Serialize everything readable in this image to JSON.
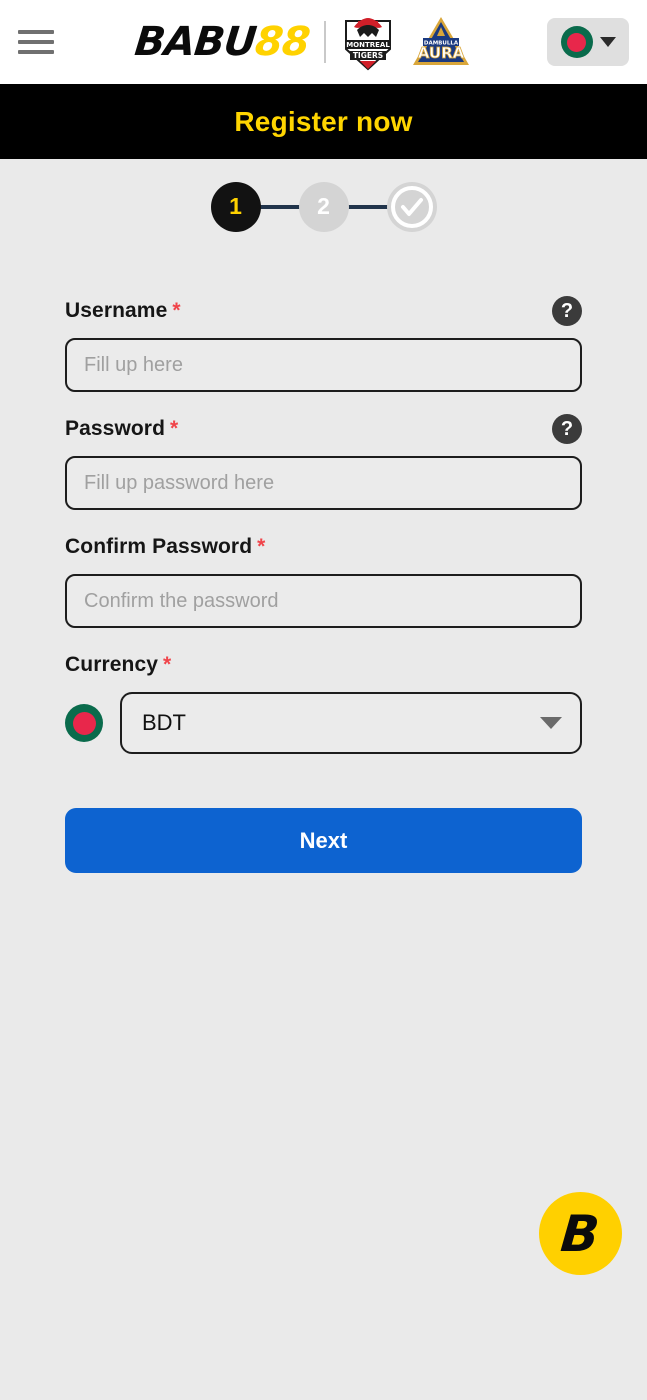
{
  "header": {
    "menu_icon": "hamburger-icon",
    "logo": {
      "primary": "BABU",
      "accent": "88"
    },
    "sponsors": [
      {
        "name": "Montreal Tigers",
        "line1": "MONTREAL",
        "line2": "TIGERS"
      },
      {
        "name": "Aura",
        "line1": "DAMBULLA",
        "line2": "AURA"
      }
    ],
    "language": {
      "flag": "bangladesh-flag-icon",
      "caret": "chevron-down-icon"
    }
  },
  "banner": {
    "title": "Register now"
  },
  "steps": {
    "items": [
      {
        "label": "1",
        "state": "active"
      },
      {
        "label": "2",
        "state": "inactive"
      },
      {
        "label": "check-icon",
        "state": "complete"
      }
    ]
  },
  "form": {
    "username": {
      "label": "Username",
      "required_mark": "*",
      "placeholder": "Fill up here",
      "value": "",
      "help": "?"
    },
    "password": {
      "label": "Password",
      "required_mark": "*",
      "placeholder": "Fill up password here",
      "value": "",
      "help": "?"
    },
    "confirm_password": {
      "label": "Confirm Password",
      "required_mark": "*",
      "placeholder": "Confirm the password",
      "value": ""
    },
    "currency": {
      "label": "Currency",
      "required_mark": "*",
      "selected": "BDT",
      "options": [
        "BDT"
      ],
      "flag": "bangladesh-flag-icon"
    },
    "submit": {
      "label": "Next"
    }
  },
  "fab": {
    "label": "B"
  },
  "colors": {
    "page_bg": "#eaeaea",
    "banner_bg": "#000000",
    "banner_text": "#ffd500",
    "accent_yellow": "#ffd200",
    "primary_blue": "#0d63d0",
    "required_red": "#f0444a",
    "flag_green": "#0a6b4c",
    "flag_red": "#e8274b",
    "step_line": "#21344b"
  }
}
